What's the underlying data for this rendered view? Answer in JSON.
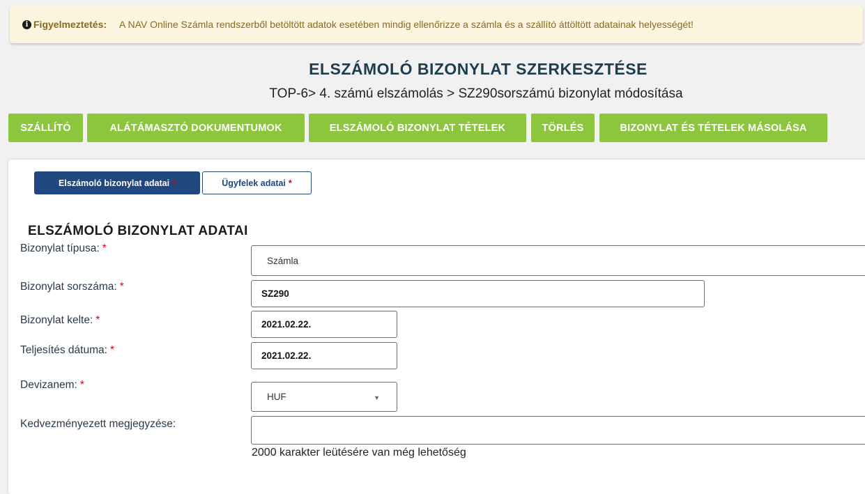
{
  "warning": {
    "icon": "info-icon",
    "label": "Figyelmeztetés:",
    "message": "A NAV Online Számla rendszerből betöltött adatok esetében mindig ellenőrizze a számla és a szállító áttöltött adatainak helyességét!"
  },
  "page": {
    "title": "ELSZÁMOLÓ BIZONYLAT SZERKESZTÉSE",
    "breadcrumb": "TOP-6> 4. számú elszámolás > SZ290sorszámú bizonylat módosítása"
  },
  "toolbar": {
    "supplier": "SZÁLLÍTÓ",
    "documents": "ALÁTÁMASZTÓ DOKUMENTUMOK",
    "items": "ELSZÁMOLÓ BIZONYLAT TÉTELEK",
    "delete": "TÖRLÉS",
    "copy": "BIZONYLAT ÉS TÉTELEK MÁSOLÁSA"
  },
  "tabs": {
    "document_data": "Elszámoló bizonylat adatai",
    "clients_data": "Ügyfelek adatai",
    "required_mark": "*"
  },
  "section": {
    "title": "ELSZÁMOLÓ BIZONYLAT ADATAI"
  },
  "form": {
    "required_mark": "*",
    "doc_type": {
      "label": "Bizonylat típusa:",
      "value": "Számla"
    },
    "doc_number": {
      "label": "Bizonylat sorszáma:",
      "value": "SZ290"
    },
    "doc_date": {
      "label": "Bizonylat kelte:",
      "value": "2021.02.22."
    },
    "fulfillment_date": {
      "label": "Teljesítés dátuma:",
      "value": "2021.02.22."
    },
    "currency": {
      "label": "Devizanem:",
      "value": "HUF"
    },
    "beneficiary_note": {
      "label": "Kedvezményezett megjegyzése:",
      "value": ""
    },
    "char_hint": "2000 karakter leütésére van még lehetőség"
  },
  "colors": {
    "green": "#8cc63f",
    "navy": "#20477f",
    "warning_bg": "#fbf4df",
    "required": "#d0021b"
  }
}
